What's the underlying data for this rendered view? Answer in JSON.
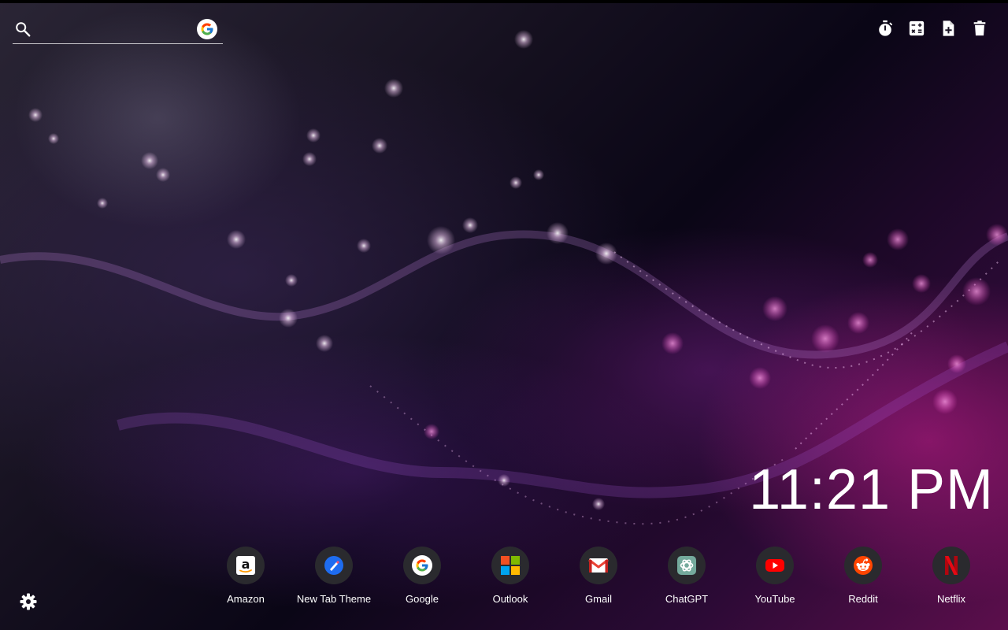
{
  "search": {
    "value": "",
    "placeholder": "",
    "engine_icon": "google-g-icon"
  },
  "toolbar": {
    "buttons": [
      {
        "icon": "timer-icon"
      },
      {
        "icon": "calculator-icon"
      },
      {
        "icon": "add-note-icon"
      },
      {
        "icon": "trash-icon"
      }
    ]
  },
  "clock": {
    "time": "11:21 PM"
  },
  "shortcuts": [
    {
      "label": "Amazon",
      "icon": "amazon-icon"
    },
    {
      "label": "New Tab Theme",
      "icon": "new-tab-theme-icon"
    },
    {
      "label": "Google",
      "icon": "google-icon"
    },
    {
      "label": "Outlook",
      "icon": "microsoft-icon"
    },
    {
      "label": "Gmail",
      "icon": "gmail-icon"
    },
    {
      "label": "ChatGPT",
      "icon": "chatgpt-icon"
    },
    {
      "label": "YouTube",
      "icon": "youtube-icon"
    },
    {
      "label": "Reddit",
      "icon": "reddit-icon"
    },
    {
      "label": "Netflix",
      "icon": "netflix-icon"
    }
  ],
  "settings": {
    "icon": "gear-icon"
  },
  "colors": {
    "tile_bg": "#2a2a2e",
    "text": "#ffffff",
    "google_blue": "#4285F4",
    "google_red": "#EA4335",
    "google_yellow": "#FBBC05",
    "google_green": "#34A853",
    "youtube_red": "#FF0000",
    "reddit_orange": "#FF4500",
    "netflix_red": "#E50914",
    "chatgpt_green": "#74AA9C"
  }
}
